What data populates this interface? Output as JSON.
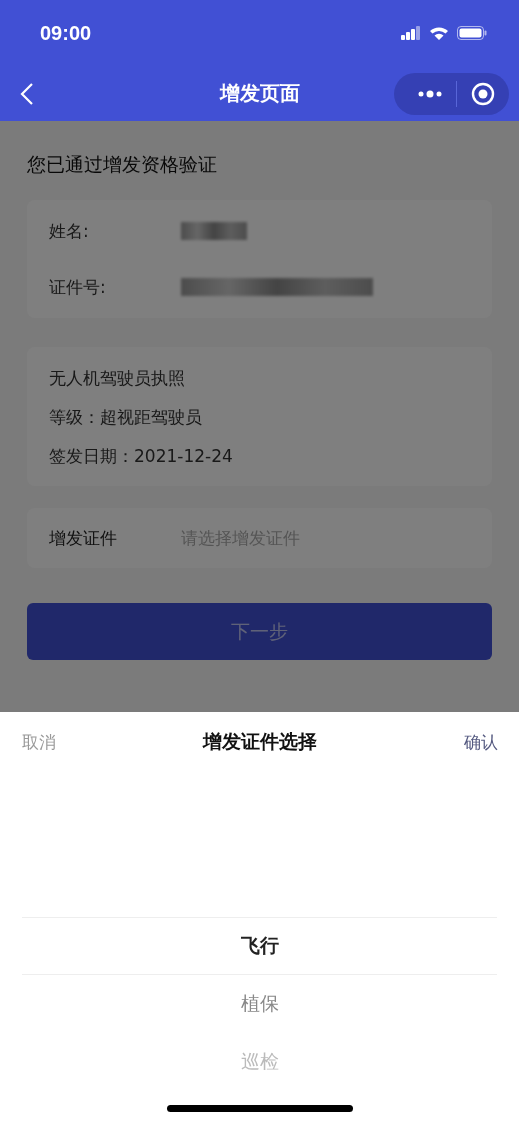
{
  "status_bar": {
    "time": "09:00"
  },
  "nav_bar": {
    "title": "增发页面"
  },
  "page": {
    "heading": "您已通过增发资格验证",
    "identity_rows": [
      {
        "label": "姓名:"
      },
      {
        "label": "证件号:"
      }
    ],
    "license_lines": [
      "无人机驾驶员执照",
      "等级：超视距驾驶员",
      "签发日期：2021-12-24"
    ],
    "field": {
      "label": "增发证件",
      "placeholder": "请选择增发证件"
    },
    "next_button": "下一步"
  },
  "picker_sheet": {
    "cancel": "取消",
    "title": "增发证件选择",
    "confirm": "确认",
    "options": [
      {
        "label": "飞行",
        "selected": true
      },
      {
        "label": "植保",
        "selected": false
      },
      {
        "label": "巡检",
        "selected": false
      }
    ]
  }
}
